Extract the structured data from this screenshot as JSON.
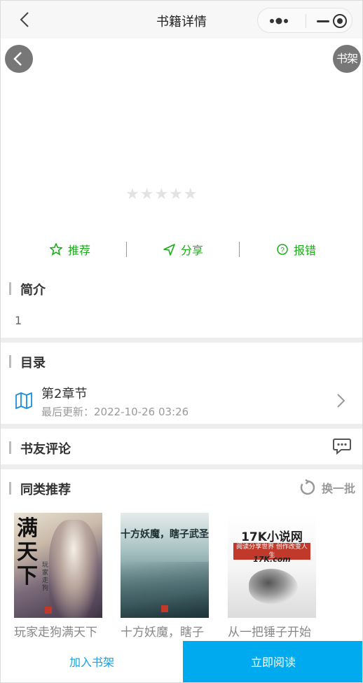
{
  "header": {
    "title": "书籍详情"
  },
  "float": {
    "shelf_label": "书架"
  },
  "rating": {
    "stars": "★★★★★",
    "value": 0,
    "max": 5
  },
  "actions": {
    "recommend": "推荐",
    "share": "分享",
    "report": "报错"
  },
  "intro": {
    "title": "简介",
    "text": "1"
  },
  "catalog": {
    "title": "目录",
    "chapter": "第2章节",
    "updated": "最后更新：2022-10-26 03:26"
  },
  "comments": {
    "title": "书友评论"
  },
  "similar": {
    "title": "同类推荐",
    "refresh_label": "换一批",
    "books": [
      {
        "title": "玩家走狗满天下",
        "cover_text": "满天下",
        "cover_sub": "玩家走狗"
      },
      {
        "title": "十方妖魔，瞎子",
        "cover_text": "十方妖魔，瞎子武圣",
        "cover_sub": ""
      },
      {
        "title": "从一把锤子开始",
        "cover_text": "17K小说网",
        "cover_slogan": "阅读分享世界 创作改变人生",
        "cover_mark": "17K.com"
      }
    ]
  },
  "bottom": {
    "add_label": "加入书架",
    "read_label": "立即阅读"
  },
  "colors": {
    "accent_green": "#1aad19",
    "read_button": "#00aaee",
    "add_text": "#19a0e0"
  }
}
